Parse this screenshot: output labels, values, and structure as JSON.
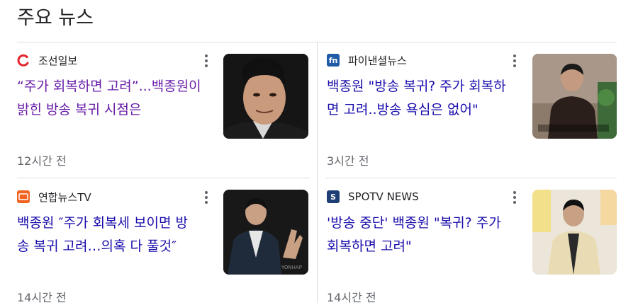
{
  "section": {
    "title": "주요 뉴스"
  },
  "cards": [
    {
      "source": "조선일보",
      "logo_text": "",
      "logo_color": "#e4252d",
      "headline": "“주가 회복하면 고려”...백종원이\n밝힌 방송 복귀 시점은",
      "time": "12시간 전",
      "visited": true
    },
    {
      "source": "파이낸셜뉴스",
      "logo_text": "fn",
      "logo_color": "#1e5aa5",
      "headline": "백종원 \"방송 복귀? 주가 회복하\n면 고려..방송 욕심은 없어\"",
      "time": "3시간 전",
      "visited": false
    },
    {
      "source": "연합뉴스TV",
      "logo_text": "",
      "logo_color": "#f06320",
      "headline": "백종원 ″주가 회복세 보이면 방\n송 복귀 고려…의혹 다 풀것″",
      "time": "14시간 전",
      "visited": false
    },
    {
      "source": "SPOTV NEWS",
      "logo_text": "S",
      "logo_color": "#1d3f74",
      "headline": "'방송 중단' 백종원 \"복귀? 주가\n회복하면 고려\"",
      "time": "14시간 전",
      "visited": false
    }
  ],
  "colors": {
    "link": "#1a0dab",
    "link_visited": "#681da8",
    "meta": "#5f6368"
  }
}
